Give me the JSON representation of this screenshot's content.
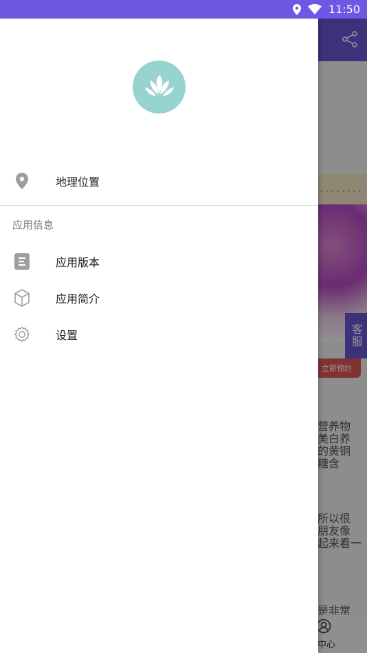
{
  "status_bar": {
    "time": "11:50",
    "icons": [
      "location-icon",
      "wifi-icon"
    ]
  },
  "background": {
    "share_icon": "share-icon",
    "kefu_label": "客服",
    "reserve_button": "立即预约",
    "snippets": [
      "营养物",
      "美白养",
      "的黄铜",
      "糖含",
      "所以很",
      "朋友像",
      "起来看一",
      "是非常"
    ],
    "bottom_nav_label": "中心"
  },
  "drawer": {
    "logo": "lotus-logo",
    "items_top": [
      {
        "label": "地理位置",
        "icon": "location-pin-icon"
      }
    ],
    "section_title": "应用信息",
    "items_info": [
      {
        "label": "应用版本",
        "icon": "document-icon"
      },
      {
        "label": "应用简介",
        "icon": "cube-icon"
      },
      {
        "label": "设置",
        "icon": "gear-icon"
      }
    ]
  },
  "colors": {
    "status_bar": "#6f57e4",
    "header": "#6a55d6",
    "logo_bg": "#97d3cf",
    "icon_gray": "#9e9e9e"
  }
}
